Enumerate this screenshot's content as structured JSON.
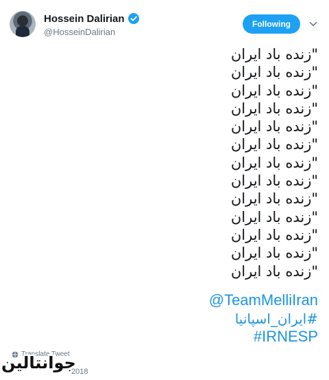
{
  "author": {
    "display_name": "Hossein Dalirian",
    "handle": "@HosseinDalirian",
    "verified": true
  },
  "follow_button": {
    "label": "Following",
    "color": "#1da1f2"
  },
  "tweet": {
    "lines": [
      "\"زنده باد ایران",
      "\"زنده باد ایران",
      "\"زنده باد ایران",
      "\"زنده باد ایران",
      "\"زنده باد ایران",
      "\"زنده باد ایران",
      "\"زنده باد ایران",
      "\"زنده باد ایران",
      "\"زنده باد ایران",
      "\"زنده باد ایران",
      "\"زنده باد ایران",
      "\"زنده باد ایران",
      "\"زنده باد ایران"
    ],
    "mention": "@TeamMelliIran",
    "hashtag_fa": "#ایران_اسپانیا",
    "hashtag_en": "#IRNESP",
    "link_color": "#1b95e0"
  },
  "footer": {
    "translate_label": "Translate Tweet",
    "timestamp": "2018"
  },
  "watermark": {
    "text": "جوانتالین"
  },
  "icons": {
    "verified": "verified-badge-icon",
    "caret": "chevron-down-icon",
    "globe": "globe-icon"
  }
}
